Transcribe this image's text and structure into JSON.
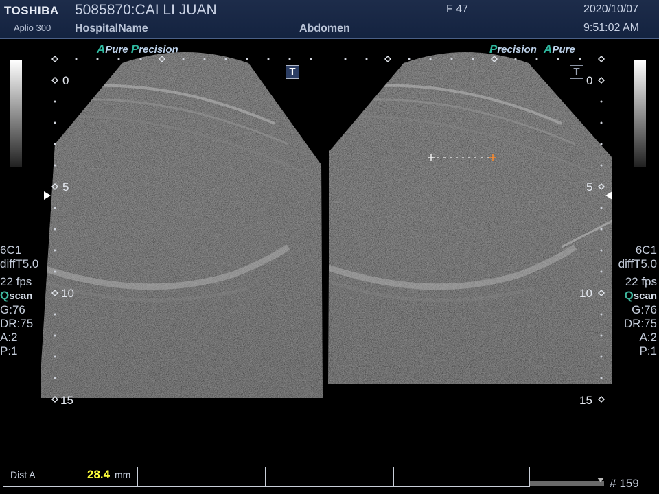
{
  "header": {
    "brand": "TOSHIBA",
    "model": "Aplio 300",
    "patient": "5085870:CAI LI JUAN",
    "hospital": "HospitalName",
    "sex_age": "F  47",
    "exam": "Abdomen",
    "date": "2020/10/07",
    "time": "9:51:02 AM"
  },
  "left_view": {
    "label_a": "A",
    "label_pure": "Pure",
    "label_p": "P",
    "label_precision": "recision",
    "t_icon": "T",
    "depths": [
      "0",
      "5",
      "10",
      "15"
    ]
  },
  "right_view": {
    "label_p": "P",
    "label_precision": "recision",
    "label_a": "A",
    "label_pure": "Pure",
    "t_icon": "T",
    "depths": [
      "0",
      "5",
      "10",
      "15"
    ]
  },
  "params": {
    "probe": "6C1",
    "mode": "diffT5.0",
    "fps": "22 fps",
    "qscan_q": "Q",
    "qscan_rest": "scan",
    "gain": "G:76",
    "dr": "DR:75",
    "a": "A:2",
    "p": "P:1"
  },
  "measurement": {
    "label": "Dist A",
    "value": "28.4",
    "unit": "mm"
  },
  "frame": {
    "hash": "#",
    "number": "159"
  },
  "colors": {
    "accent": "#2fb89f",
    "value_yellow": "#ffff3a",
    "header_bg": "#1d2c4a"
  },
  "icons": {
    "t_icon": "text-T-box",
    "cursor": "plus-crosshair"
  }
}
